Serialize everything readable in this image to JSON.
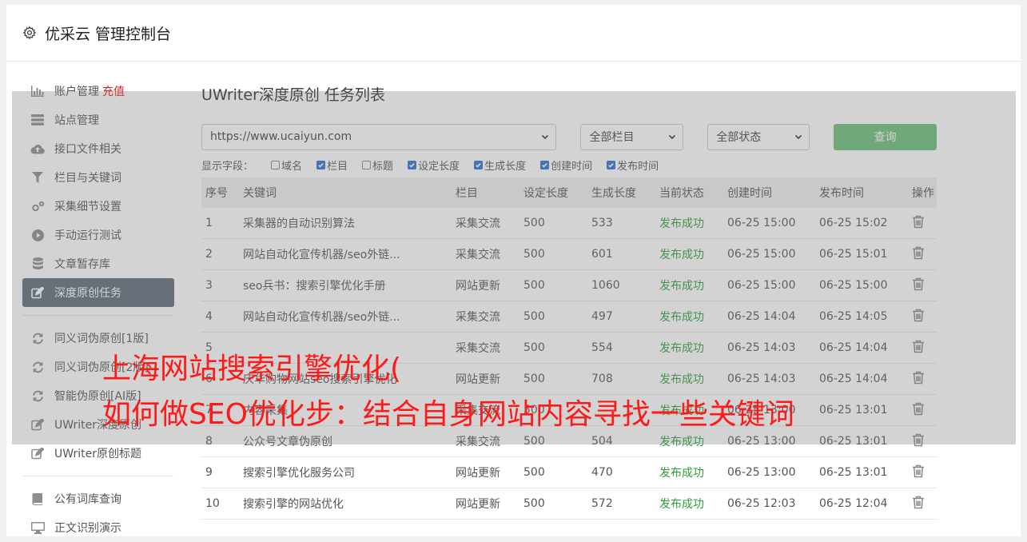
{
  "header": {
    "title": "优采云 管理控制台"
  },
  "sidebar": {
    "items": [
      {
        "label": "账户管理",
        "extra": "充值",
        "icon": "bar-chart-icon"
      },
      {
        "label": "站点管理",
        "icon": "server-icon"
      },
      {
        "label": "接口文件相关",
        "icon": "cloud-upload-icon"
      },
      {
        "label": "栏目与关键词",
        "icon": "filter-icon"
      },
      {
        "label": "采集细节设置",
        "icon": "gears-icon"
      },
      {
        "label": "手动运行测试",
        "icon": "play-icon"
      },
      {
        "label": "文章暂存库",
        "icon": "database-icon"
      },
      {
        "label": "深度原创任务",
        "icon": "edit-icon",
        "active": true
      },
      {
        "label": "同义词伪原创[1版]",
        "icon": "refresh-icon"
      },
      {
        "label": "同义词伪原创[2版]",
        "icon": "refresh-icon"
      },
      {
        "label": "智能伪原创[AI版]",
        "icon": "refresh-icon"
      },
      {
        "label": "UWriter深度原创",
        "icon": "edit-icon"
      },
      {
        "label": "UWriter原创标题",
        "icon": "edit-icon"
      },
      {
        "label": "公有词库查询",
        "icon": "book-icon"
      },
      {
        "label": "正文识别演示",
        "icon": "monitor-icon"
      }
    ]
  },
  "main": {
    "title": "UWriter深度原创 任务列表",
    "filters": {
      "site": "https://www.ucaiyun.com",
      "column": "全部栏目",
      "status": "全部状态",
      "query_label": "查询"
    },
    "fields": {
      "label": "显示字段：",
      "options": [
        {
          "label": "域名",
          "checked": false
        },
        {
          "label": "栏目",
          "checked": true
        },
        {
          "label": "标题",
          "checked": false
        },
        {
          "label": "设定长度",
          "checked": true
        },
        {
          "label": "生成长度",
          "checked": true
        },
        {
          "label": "创建时间",
          "checked": true
        },
        {
          "label": "发布时间",
          "checked": true
        }
      ]
    },
    "table": {
      "headers": [
        "序号",
        "关键词",
        "栏目",
        "设定长度",
        "生成长度",
        "当前状态",
        "创建时间",
        "发布时间",
        "操作"
      ],
      "rows": [
        [
          "1",
          "采集器的自动识别算法",
          "采集交流",
          "500",
          "533",
          "发布成功",
          "06-25 15:00",
          "06-25 15:02"
        ],
        [
          "2",
          "网站自动化宣传机器/seo外链...",
          "采集交流",
          "500",
          "601",
          "发布成功",
          "06-25 15:00",
          "06-25 15:01"
        ],
        [
          "3",
          "seo兵书：搜索引擎优化手册",
          "网站更新",
          "500",
          "1060",
          "发布成功",
          "06-25 15:00",
          "06-25 15:00"
        ],
        [
          "4",
          "网站自动化宣传机器/seo外链...",
          "采集交流",
          "500",
          "497",
          "发布成功",
          "06-25 14:04",
          "06-25 14:05"
        ],
        [
          "5",
          "",
          "采集交流",
          "500",
          "554",
          "发布成功",
          "06-25 14:03",
          "06-25 14:04"
        ],
        [
          "6",
          "庆华购物网站seo搜索引擎优化",
          "网站更新",
          "500",
          "708",
          "发布成功",
          "06-25 14:03",
          "06-25 14:04"
        ],
        [
          "7",
          "内容采集",
          "采集交流",
          "500",
          "",
          "发布成功",
          "06-25 13:00",
          "06-25 13:01"
        ],
        [
          "8",
          "公众号文章伪原创",
          "采集交流",
          "500",
          "504",
          "发布成功",
          "06-25 13:00",
          "06-25 13:01"
        ],
        [
          "9",
          "搜索引擎优化服务公司",
          "网站更新",
          "500",
          "470",
          "发布成功",
          "06-25 13:00",
          "06-25 13:01"
        ],
        [
          "10",
          "搜索引擎的网站优化",
          "网站更新",
          "500",
          "572",
          "发布成功",
          "06-25 12:03",
          "06-25 12:04"
        ]
      ]
    }
  },
  "overlay": {
    "line1": "上海网站搜索引擎优化(",
    "line2": "如何做SEO优化步：结合自身网站内容寻找一些关键词"
  }
}
